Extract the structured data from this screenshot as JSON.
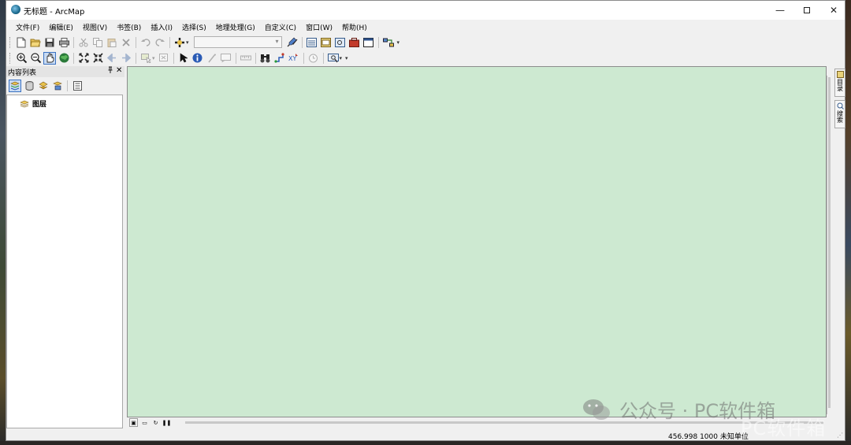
{
  "window": {
    "title": "无标题 - ArcMap",
    "controls": {
      "minimize": "—",
      "maximize": "",
      "close": "✕"
    }
  },
  "menubar": {
    "items": [
      "文件(F)",
      "编辑(E)",
      "视图(V)",
      "书签(B)",
      "插入(I)",
      "选择(S)",
      "地理处理(G)",
      "自定义(C)",
      "窗口(W)",
      "帮助(H)"
    ]
  },
  "toolbar_standard": {
    "icons": [
      "new-document-icon",
      "open-folder-icon",
      "save-icon",
      "print-icon",
      "cut-icon",
      "copy-icon",
      "paste-icon",
      "delete-icon",
      "undo-icon",
      "redo-icon",
      "add-data-icon",
      "scale-combo",
      "editor-toolbar-icon",
      "table-of-contents-icon",
      "catalog-icon",
      "search-window-icon",
      "arctoolbox-icon",
      "python-window-icon",
      "model-builder-icon"
    ],
    "scale_value": ""
  },
  "toolbar_tools": {
    "icons": [
      "zoom-in-icon",
      "zoom-out-icon",
      "pan-icon",
      "full-extent-icon",
      "fixed-zoom-in-icon",
      "fixed-zoom-out-icon",
      "back-extent-icon",
      "forward-extent-icon",
      "select-features-icon",
      "clear-selection-icon",
      "select-elements-icon",
      "identify-icon",
      "hyperlink-icon",
      "html-popup-icon",
      "measure-icon",
      "find-icon",
      "find-route-icon",
      "go-to-xy-icon",
      "time-slider-icon",
      "viewer-window-icon"
    ],
    "active": "pan-icon"
  },
  "toc": {
    "title": "内容列表",
    "pin": "ᵖ",
    "close": "✕",
    "layers_label": "图层"
  },
  "right_dock": {
    "tabs": [
      {
        "label": "目录",
        "icon": "catalog-icon"
      },
      {
        "label": "搜索",
        "icon": "search-icon"
      }
    ]
  },
  "status": {
    "coordinates": "456.998  1000 未知单位"
  },
  "watermark": {
    "text": "公众号 · PC软件箱",
    "text2": "PC软件箱"
  },
  "colors": {
    "map_background": "#cde9d1",
    "window_background": "#f0f0f0",
    "active_tool": "#c9dbf3"
  }
}
